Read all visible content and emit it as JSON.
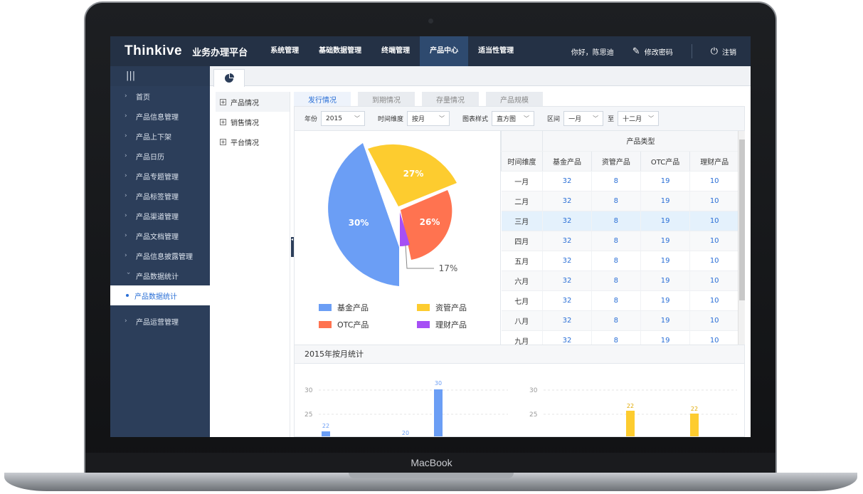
{
  "device": {
    "label": "MacBook"
  },
  "app": {
    "logo": "Thinkive",
    "platform_name": "业务办理平台",
    "nav": [
      "系统管理",
      "基础数据管理",
      "终端管理",
      "产品中心",
      "适当性管理"
    ],
    "nav_active_index": 3,
    "greeting": "你好，陈思迪",
    "change_password": "修改密码",
    "logout": "注销"
  },
  "sidebar": {
    "menu_icon": "menu-icon",
    "items": [
      "首页",
      "产品信息管理",
      "产品上下架",
      "产品日历",
      "产品专题管理",
      "产品标签管理",
      "产品渠道管理",
      "产品文档管理",
      "产品信息披露管理",
      "产品数据统计"
    ],
    "open_item": "产品数据统计",
    "sub_item": "产品数据统计",
    "bottom_item": "产品运营管理"
  },
  "tree": [
    "产品情况",
    "销售情况",
    "平台情况"
  ],
  "tabs": [
    "发行情况",
    "到期情况",
    "存量情况",
    "产品规模"
  ],
  "filters": {
    "year_label": "年份",
    "year": "2015",
    "dim_label": "时间维度",
    "dim": "按月",
    "style_label": "图表样式",
    "style": "直方图",
    "range_label": "区间",
    "range_from": "一月",
    "range_to_label": "至",
    "range_to": "十二月"
  },
  "pie": {
    "labels": {
      "c30": "30%",
      "c27": "27%",
      "c26": "26%",
      "c17": "17%"
    },
    "legend": [
      "基金产品",
      "资管产品",
      "OTC产品",
      "理财产品"
    ],
    "colors": [
      "#6b9ef5",
      "#fdcc2f",
      "#ff7350",
      "#a64ff5"
    ]
  },
  "table": {
    "group_header": "产品类型",
    "dim_header": "时间维度",
    "headers": [
      "基金产品",
      "资管产品",
      "OTC产品",
      "理财产品"
    ],
    "rows": [
      {
        "m": "一月",
        "v": [
          "32",
          "8",
          "19",
          "10"
        ]
      },
      {
        "m": "二月",
        "v": [
          "32",
          "8",
          "19",
          "10"
        ]
      },
      {
        "m": "三月",
        "v": [
          "32",
          "8",
          "19",
          "10"
        ]
      },
      {
        "m": "四月",
        "v": [
          "32",
          "8",
          "19",
          "10"
        ]
      },
      {
        "m": "五月",
        "v": [
          "32",
          "8",
          "19",
          "10"
        ]
      },
      {
        "m": "六月",
        "v": [
          "32",
          "8",
          "19",
          "10"
        ]
      },
      {
        "m": "七月",
        "v": [
          "32",
          "8",
          "19",
          "10"
        ]
      },
      {
        "m": "八月",
        "v": [
          "32",
          "8",
          "19",
          "10"
        ]
      },
      {
        "m": "九月",
        "v": [
          "32",
          "8",
          "19",
          "10"
        ]
      }
    ]
  },
  "monthly": {
    "title": "2015年按月统计",
    "chart_data": [
      {
        "type": "bar",
        "y_ticks": [
          "30",
          "25"
        ],
        "labels": [
          "22",
          "20",
          "30"
        ],
        "color": "#6b9ef5"
      },
      {
        "type": "bar",
        "y_ticks": [
          "30",
          "25"
        ],
        "labels": [
          "22",
          "22"
        ],
        "color": "#fdcc2f"
      }
    ]
  }
}
